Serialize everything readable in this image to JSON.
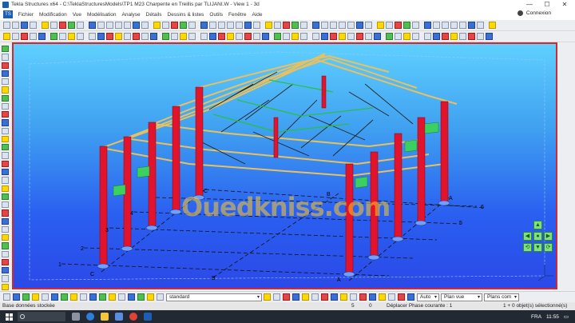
{
  "window": {
    "title": "Tekla Structures x64 - C:\\TeklaStructuresModels\\TP1 M23 Charpente en Treillis par TLIJANI.W - View 1 - 3d",
    "minimize": "—",
    "maximize": "☐",
    "close": "✕"
  },
  "menu": {
    "logo": "TS",
    "items": [
      "Fichier",
      "Modification",
      "Vue",
      "Modélisation",
      "Analyse",
      "Détails",
      "Dessins & listes",
      "Outils",
      "Fenêtre",
      "Aide"
    ],
    "connect_label": "Connexion"
  },
  "viewport": {
    "watermark": "Ouedkniss.com",
    "grid_numbers": [
      "1",
      "2",
      "3",
      "4",
      "5",
      "6"
    ],
    "grid_letters": [
      "A",
      "B",
      "C"
    ],
    "axis_labels": [
      "1",
      "2",
      "3",
      "4",
      "5",
      "6",
      "A",
      "A",
      "B",
      "B",
      "C",
      "C"
    ]
  },
  "statusbar": {
    "view_select": "standard",
    "snap_select": "Auto",
    "plane_select": "Plan vue",
    "workplane_select": "Plans com",
    "database_status": "Base données stockée",
    "num1": "5",
    "num2": "0",
    "phase": "Déplacer  Phase courante : 1",
    "selection": "1 + 0 objet(s) sélectionné(s)"
  },
  "taskbar": {
    "lang": "FRA",
    "time": "11:55"
  },
  "nav_pad": [
    "▲",
    "◀",
    "●",
    "▶",
    "▼",
    "⟲",
    "⟳"
  ]
}
